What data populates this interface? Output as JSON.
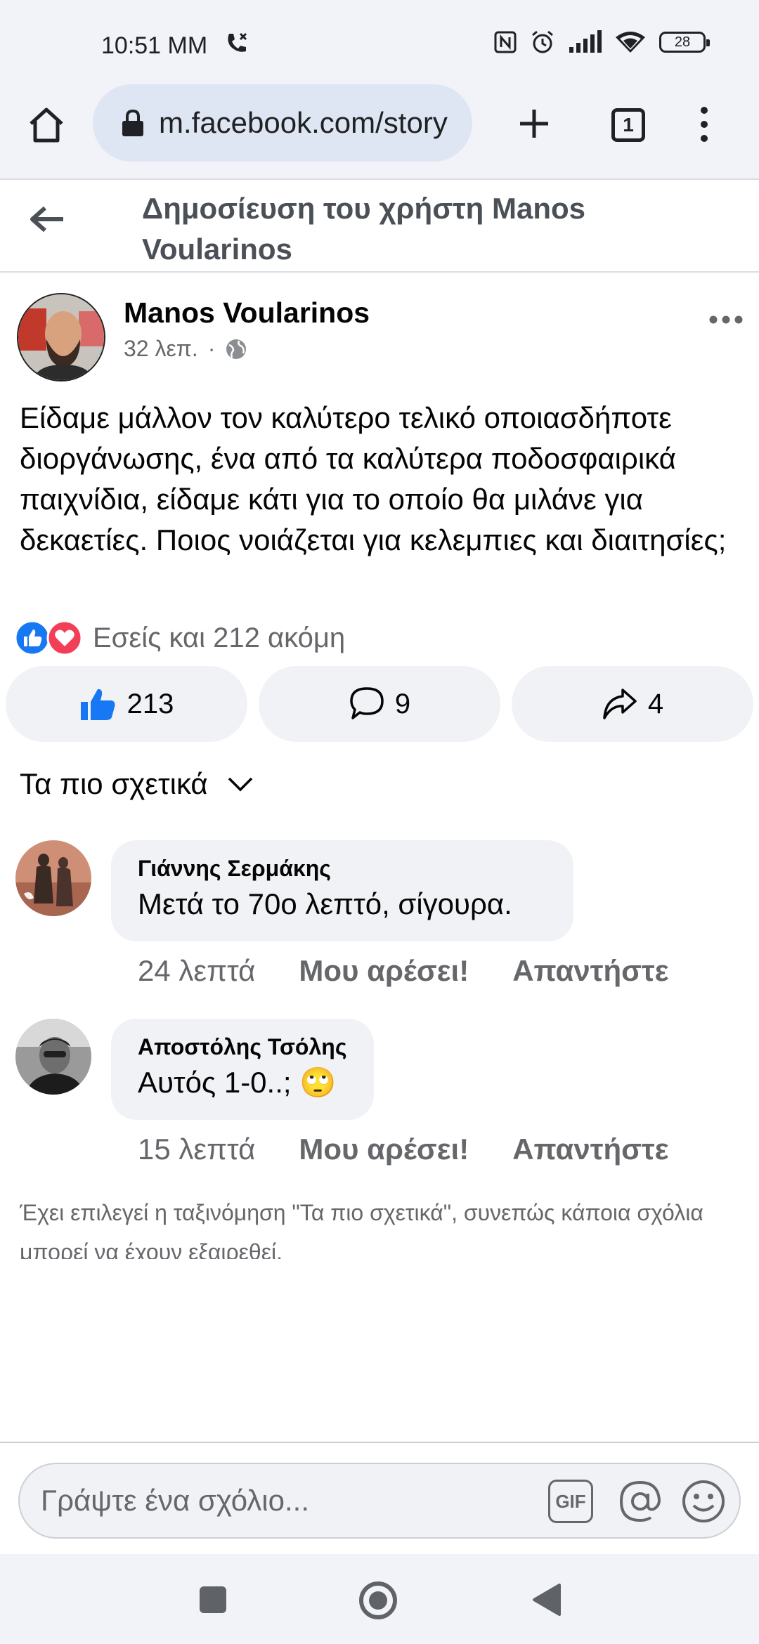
{
  "status_bar": {
    "time": "10:51 MM",
    "battery": "28"
  },
  "browser": {
    "url": "m.facebook.com/story",
    "tab_count": "1"
  },
  "header": {
    "title": "Δημοσίευση του χρήστη Manos Voularinos"
  },
  "post": {
    "author": "Manos Voularinos",
    "time": "32 λεπ.",
    "separator": "·",
    "text": "Είδαμε μάλλον τον καλύτερο τελικό οποιασδήποτε διοργάνωσης, ένα από τα καλύτερα ποδοσφαιρικά παιχνίδια, είδαμε κάτι για το οποίο θα μιλάνε για δεκαετίες. Ποιος νοιάζεται για κελεμπιες και διαιτησίες;",
    "reactions_text": "Εσείς και 212 ακόμη",
    "like_count": "213",
    "comment_count": "9",
    "share_count": "4"
  },
  "comments_section": {
    "sort_label": "Τα πιο σχετικά",
    "comments": [
      {
        "author": "Γιάννης Σερμάκης",
        "text": "Μετά το 70ο λεπτό, σίγουρα.",
        "time": "24 λεπτά",
        "like_label": "Μου αρέσει!",
        "reply_label": "Απαντήστε"
      },
      {
        "author": "Αποστόλης Τσόλης",
        "text": "Αυτός 1-0..; 🙄",
        "time": "15 λεπτά",
        "like_label": "Μου αρέσει!",
        "reply_label": "Απαντήστε"
      }
    ],
    "sort_note": "Έχει επιλεγεί η ταξινόμηση \"Τα πιο σχετικά\", συνεπώς κάποια σχόλια μπορεί να έχουν εξαιρεθεί."
  },
  "composer": {
    "placeholder": "Γράψτε ένα σχόλιο...",
    "gif_label": "GIF"
  },
  "colors": {
    "like_blue": "#1877f2",
    "love_red": "#f33e58",
    "muted": "#65676b",
    "browser_bg": "#f1f3f8"
  }
}
